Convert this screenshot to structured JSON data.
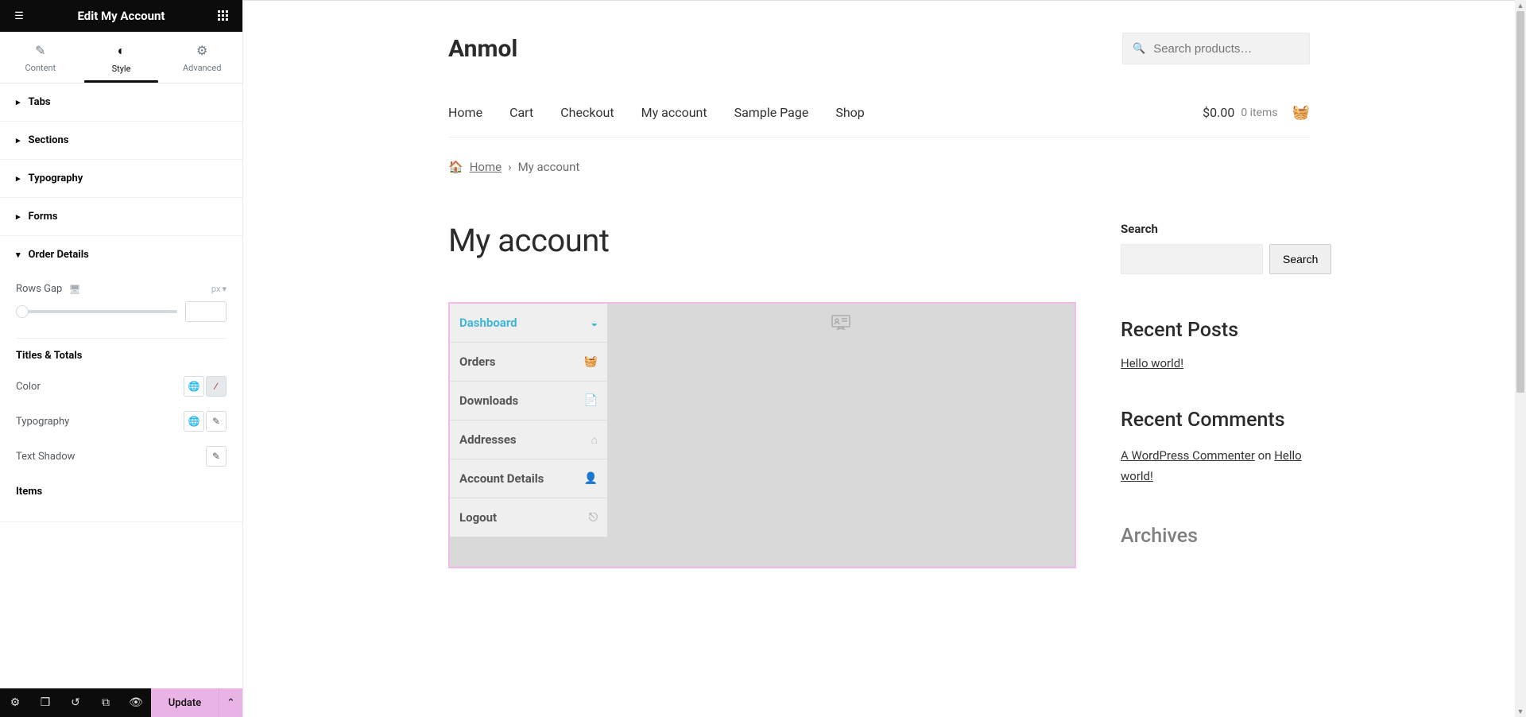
{
  "panel": {
    "title": "Edit My Account",
    "tabs": {
      "content": "Content",
      "style": "Style",
      "advanced": "Advanced"
    },
    "sections": {
      "tabs": "Tabs",
      "sections": "Sections",
      "typography": "Typography",
      "forms": "Forms",
      "order_details": "Order Details"
    },
    "controls": {
      "rows_gap": "Rows Gap",
      "unit": "px",
      "titles_totals": "Titles & Totals",
      "color": "Color",
      "typography": "Typography",
      "text_shadow": "Text Shadow",
      "items": "Items"
    },
    "footer": {
      "update": "Update"
    }
  },
  "site": {
    "title": "Anmol",
    "search_placeholder": "Search products…",
    "nav": [
      "Home",
      "Cart",
      "Checkout",
      "My account",
      "Sample Page",
      "Shop"
    ],
    "cart": {
      "total": "$0.00",
      "items": "0 items"
    },
    "breadcrumb": {
      "home": "Home",
      "current": "My account"
    },
    "page_heading": "My account",
    "account_tabs": [
      {
        "label": "Dashboard",
        "icon": "◒"
      },
      {
        "label": "Orders",
        "icon": "🧺"
      },
      {
        "label": "Downloads",
        "icon": "📄"
      },
      {
        "label": "Addresses",
        "icon": "⌂"
      },
      {
        "label": "Account Details",
        "icon": "👤"
      },
      {
        "label": "Logout",
        "icon": "⎋"
      }
    ],
    "sidebar": {
      "search_label": "Search",
      "search_button": "Search",
      "recent_posts": "Recent Posts",
      "post_hello": "Hello world!",
      "recent_comments": "Recent Comments",
      "commenter": "A WordPress Commenter",
      "on": " on ",
      "archives": "Archives"
    }
  }
}
